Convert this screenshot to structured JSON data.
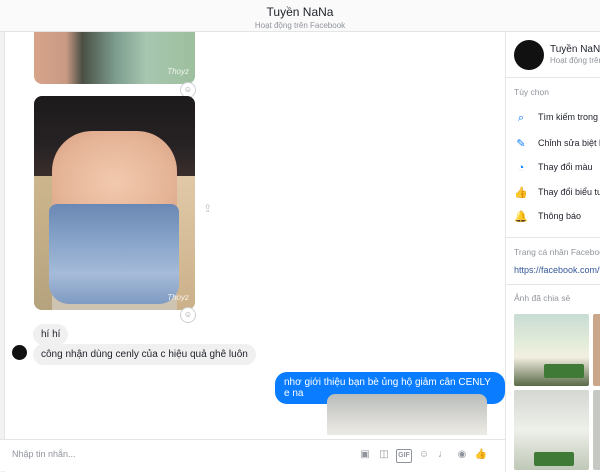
{
  "header": {
    "title": "Tuyền NaNa",
    "subtitle": "Hoạt động trên Facebook"
  },
  "chat": {
    "photo_watermark": "Thoyz",
    "messages_in": [
      "hí hí",
      "công nhận dùng cenly của c hiệu quả ghê luôn"
    ],
    "messages_out": [
      "nhơ giới thiệu bạn bè ủng hộ giảm cân CENLY e na"
    ]
  },
  "composer": {
    "placeholder": "Nhập tin nhắn...",
    "gif_label": "GIF"
  },
  "sidebar": {
    "name": "Tuyền NaNa",
    "status": "Hoạt động trên Facebook",
    "options_heading": "Tùy chọn",
    "options": [
      {
        "label": "Tìm kiếm trong cuộc trò chuyện",
        "icon": "search-icon"
      },
      {
        "label": "Chỉnh sửa biệt hiệu",
        "icon": "pencil-icon"
      },
      {
        "label": "Thay đổi màu",
        "icon": "palette-icon"
      },
      {
        "label": "Thay đổi biểu tượng cảm xúc",
        "icon": "thumbs-up-icon"
      },
      {
        "label": "Thông báo",
        "icon": "bell-icon"
      }
    ],
    "profile_heading": "Trang cá nhân Facebook",
    "profile_link": "https://facebook.com/vk",
    "shared_heading": "Ảnh đã chia sẻ"
  },
  "colors": {
    "accent": "#0a7cff",
    "bubble_in": "#f1f0f0"
  }
}
